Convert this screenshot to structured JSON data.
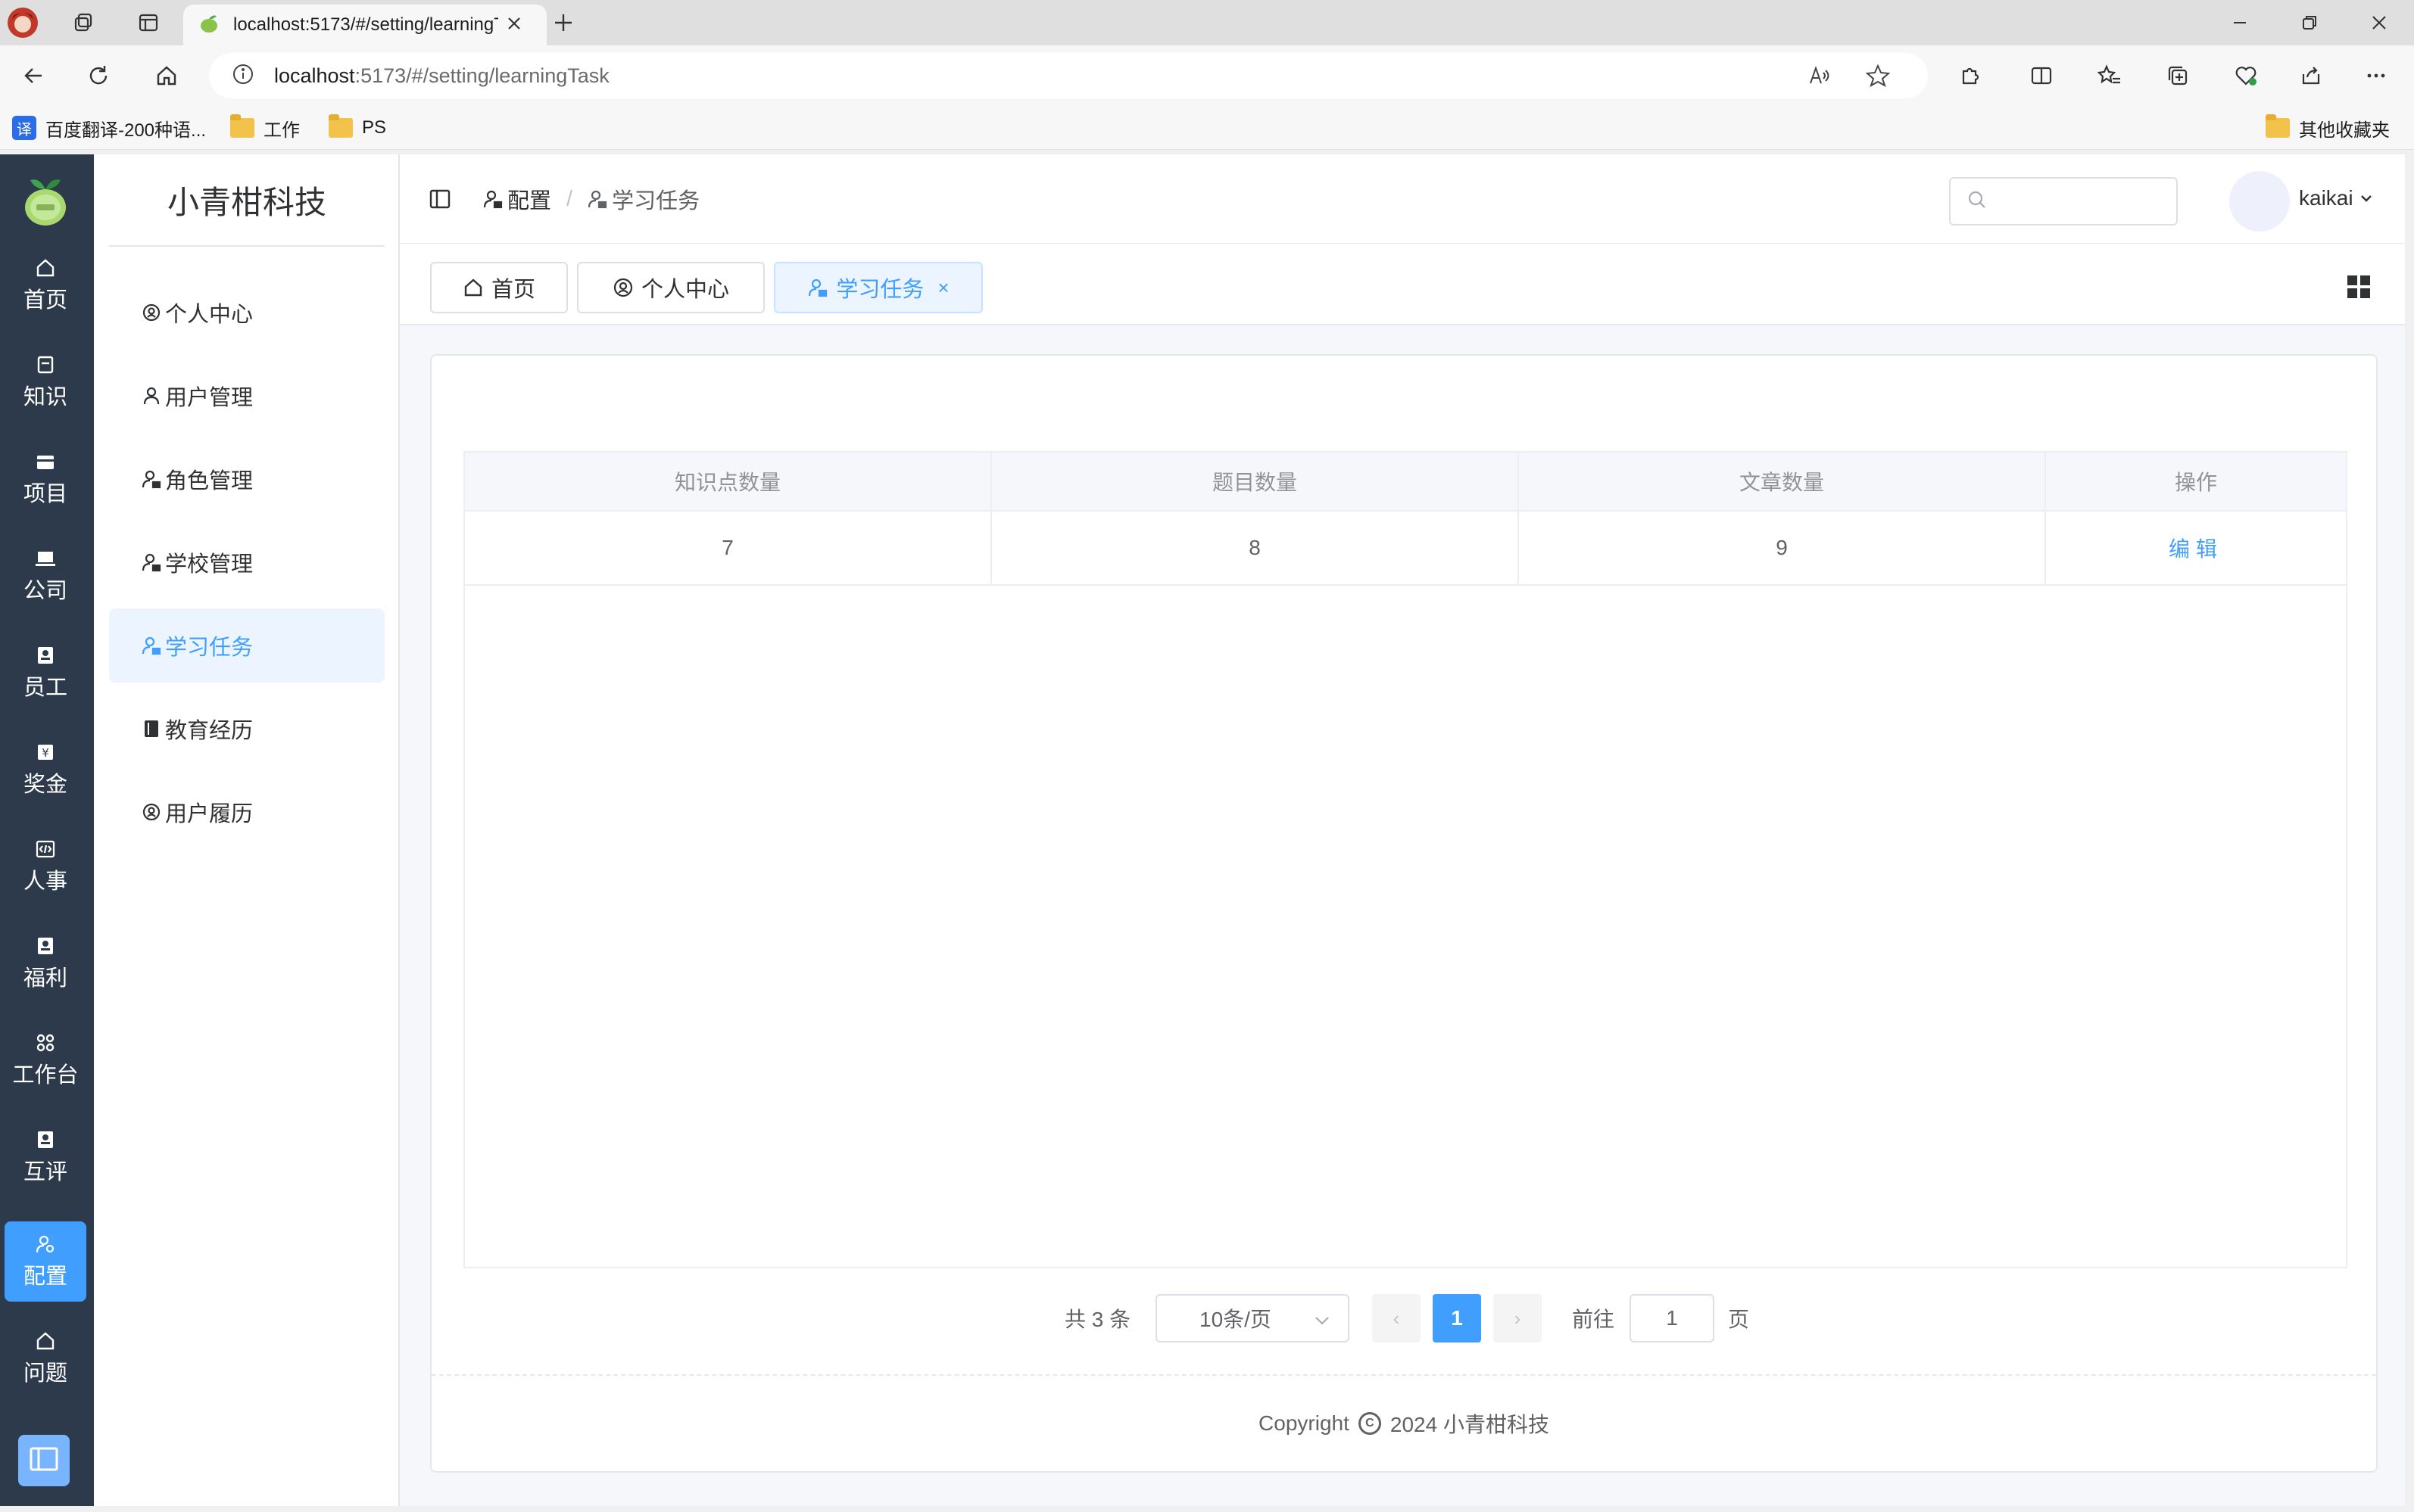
{
  "browser": {
    "tab_title": "localhost:5173/#/setting/learningTask",
    "url_host": "localhost",
    "url_rest": ":5173/#/setting/learningTask",
    "favorites": [
      {
        "label": "百度翻译-200种语..."
      },
      {
        "label": "工作"
      },
      {
        "label": "PS"
      }
    ],
    "other_favorites": "其他收藏夹",
    "fanyi_glyph": "译"
  },
  "app": {
    "brand": "小青柑科技",
    "rail": [
      {
        "label": "首页",
        "icon": "home-icon"
      },
      {
        "label": "知识",
        "icon": "document-icon"
      },
      {
        "label": "项目",
        "icon": "folder-icon"
      },
      {
        "label": "公司",
        "icon": "laptop-icon"
      },
      {
        "label": "员工",
        "icon": "badge-icon"
      },
      {
        "label": "奖金",
        "icon": "money-icon"
      },
      {
        "label": "人事",
        "icon": "code-icon"
      },
      {
        "label": "福利",
        "icon": "badge-icon"
      },
      {
        "label": "工作台",
        "icon": "grid-icon"
      },
      {
        "label": "互评",
        "icon": "badge-icon"
      },
      {
        "label": "配置",
        "icon": "user-setting-icon",
        "active": true
      },
      {
        "label": "问题",
        "icon": "home-icon"
      }
    ],
    "submenu": [
      {
        "label": "个人中心",
        "icon": "location-icon"
      },
      {
        "label": "用户管理",
        "icon": "user-icon"
      },
      {
        "label": "角色管理",
        "icon": "user-lock-icon"
      },
      {
        "label": "学校管理",
        "icon": "user-lock-icon"
      },
      {
        "label": "学习任务",
        "icon": "user-lock-icon",
        "active": true
      },
      {
        "label": "教育经历",
        "icon": "book-icon"
      },
      {
        "label": "用户履历",
        "icon": "location-icon"
      }
    ],
    "breadcrumb": [
      "配置",
      "学习任务"
    ],
    "user": "kaikai",
    "tags": [
      {
        "label": "首页",
        "icon": "home-icon"
      },
      {
        "label": "个人中心",
        "icon": "location-icon"
      },
      {
        "label": "学习任务",
        "icon": "user-lock-icon",
        "active": true,
        "close": "×"
      }
    ]
  },
  "table": {
    "columns": [
      "知识点数量",
      "题目数量",
      "文章数量",
      "操作"
    ],
    "rows": [
      {
        "knowledge": "7",
        "questions": "8",
        "articles": "9",
        "action": "编辑"
      }
    ]
  },
  "pagination": {
    "total_text": "共 3 条",
    "page_size": "10条/页",
    "prev": "‹",
    "current_page": "1",
    "next": "›",
    "goto_label": "前往",
    "goto_value": "1",
    "page_suffix": "页"
  },
  "footer": {
    "copyright_prefix": "Copyright",
    "copyright_symbol": "C",
    "copyright_year_company": "2024 小青柑科技"
  },
  "colors": {
    "primary": "#409eff",
    "sidebar_bg": "#2d3a4b",
    "active_bg": "#ecf5ff"
  }
}
